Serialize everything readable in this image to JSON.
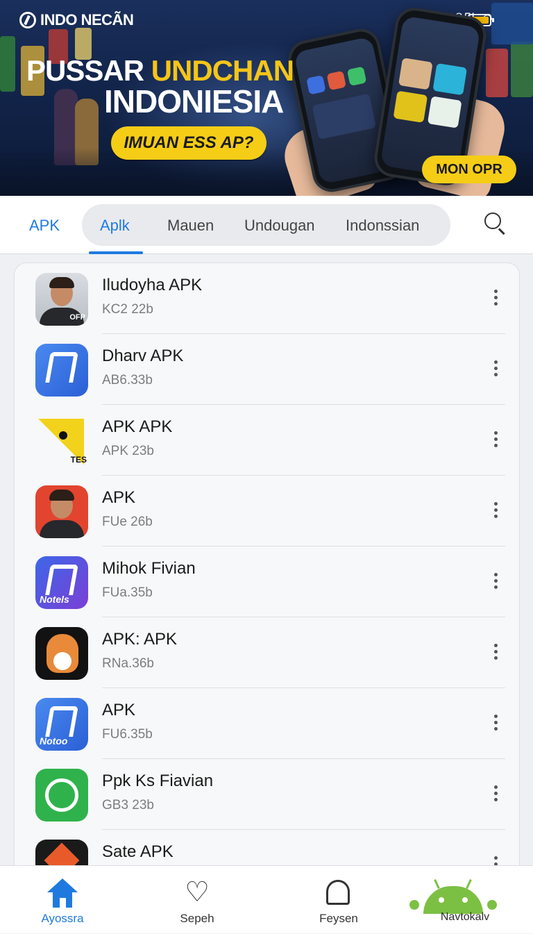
{
  "hero": {
    "brand": "INDO NECÃN",
    "status_time": "8ЛI",
    "headline_part1": "PUSSAR ",
    "headline_highlight": "UNDCHAN",
    "headline_line2": "INDONIESIA",
    "cta": "IMUAN ESS AP?",
    "secondary_cta": "MON OPR"
  },
  "tabs": {
    "left_label": "APK",
    "items": [
      {
        "label": "Aplk",
        "active": true
      },
      {
        "label": "Mauen",
        "active": false
      },
      {
        "label": "Undougan",
        "active": false
      },
      {
        "label": "Indonssian",
        "active": false
      }
    ],
    "search_icon": "search-icon"
  },
  "apps": [
    {
      "name": "Iludoyha APK",
      "meta": "KC2 22b",
      "icon": "person-icon"
    },
    {
      "name": "Dharv APK",
      "meta": "AB6.33b",
      "icon": "blue-a-icon"
    },
    {
      "name": "APK APK",
      "meta": "APK 23b",
      "icon": "yellow-triangle-icon"
    },
    {
      "name": "APK",
      "meta": "FUe 26b",
      "icon": "person-red-icon"
    },
    {
      "name": "Mihok Fivian",
      "meta": "FUa.35b",
      "icon": "notels-icon"
    },
    {
      "name": "APK: APK",
      "meta": "RNa.36b",
      "icon": "fox-icon"
    },
    {
      "name": "APK",
      "meta": "FU6.35b",
      "icon": "blue-a-icon"
    },
    {
      "name": "Ppk Ks Fiavian",
      "meta": "GB3 23b",
      "icon": "whatsapp-icon"
    },
    {
      "name": "Sate APK",
      "meta": "",
      "icon": "dark-arrow-icon"
    }
  ],
  "icon_captions": {
    "person_tag": "OFP",
    "blue_cap": "",
    "notels": "Notels",
    "tes": "TES",
    "fox_tag": "",
    "blue2_cap": "Notoo",
    "person_red_tag": ""
  },
  "bottom_nav": [
    {
      "label": "Ayossra",
      "icon": "home-icon",
      "active": true
    },
    {
      "label": "Sepeh",
      "icon": "heart-icon",
      "active": false
    },
    {
      "label": "Feysen",
      "icon": "bell-icon",
      "active": false
    },
    {
      "label": "Navtokalv",
      "icon": "android-icon",
      "active": false
    }
  ],
  "colors": {
    "accent": "#1f7ae0",
    "highlight_yellow": "#f5c518",
    "android_green": "#7cc043"
  }
}
